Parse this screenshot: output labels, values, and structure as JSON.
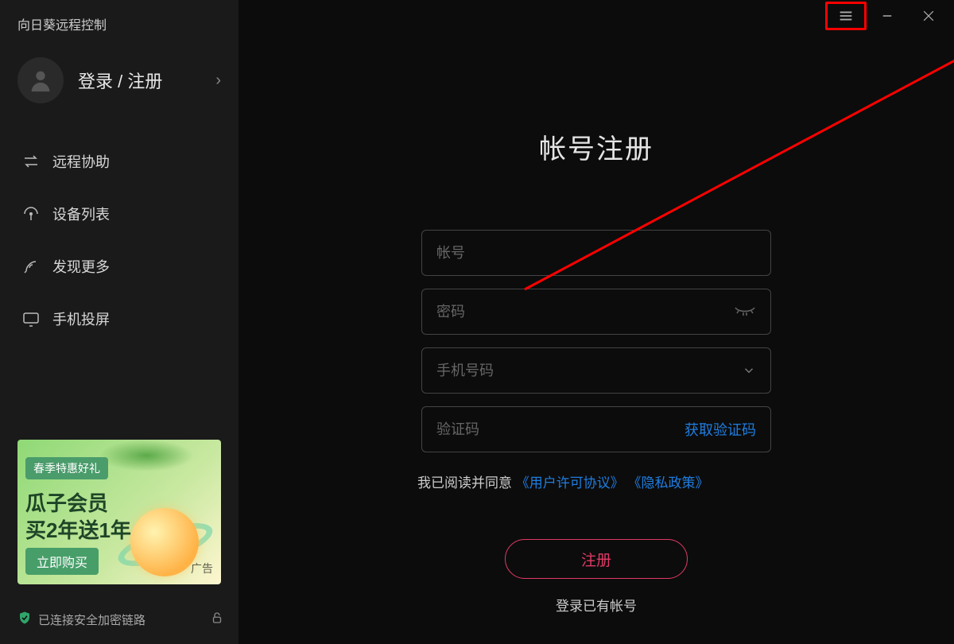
{
  "app_title": "向日葵远程控制",
  "login_register_label": "登录 / 注册",
  "sidebar": {
    "items": [
      {
        "label": "远程协助"
      },
      {
        "label": "设备列表"
      },
      {
        "label": "发现更多"
      },
      {
        "label": "手机投屏"
      }
    ]
  },
  "ad": {
    "badge": "春季特惠好礼",
    "line1": "瓜子会员",
    "line2": "买2年送1年",
    "button": "立即购买",
    "tag": "广告"
  },
  "status_text": "已连接安全加密链路",
  "form": {
    "title": "帐号注册",
    "account_placeholder": "帐号",
    "password_placeholder": "密码",
    "phone_placeholder": "手机号码",
    "code_placeholder": "验证码",
    "get_code_label": "获取验证码",
    "agree_prefix": "我已阅读并同意",
    "agree_link1": "《用户许可协议》",
    "agree_link2": "《隐私政策》",
    "submit_label": "注册",
    "login_link": "登录已有帐号"
  },
  "colors": {
    "accent_red": "#e03a66",
    "link_blue": "#1f7de0",
    "status_green": "#2fa56a",
    "highlight_red": "#ff0000"
  }
}
